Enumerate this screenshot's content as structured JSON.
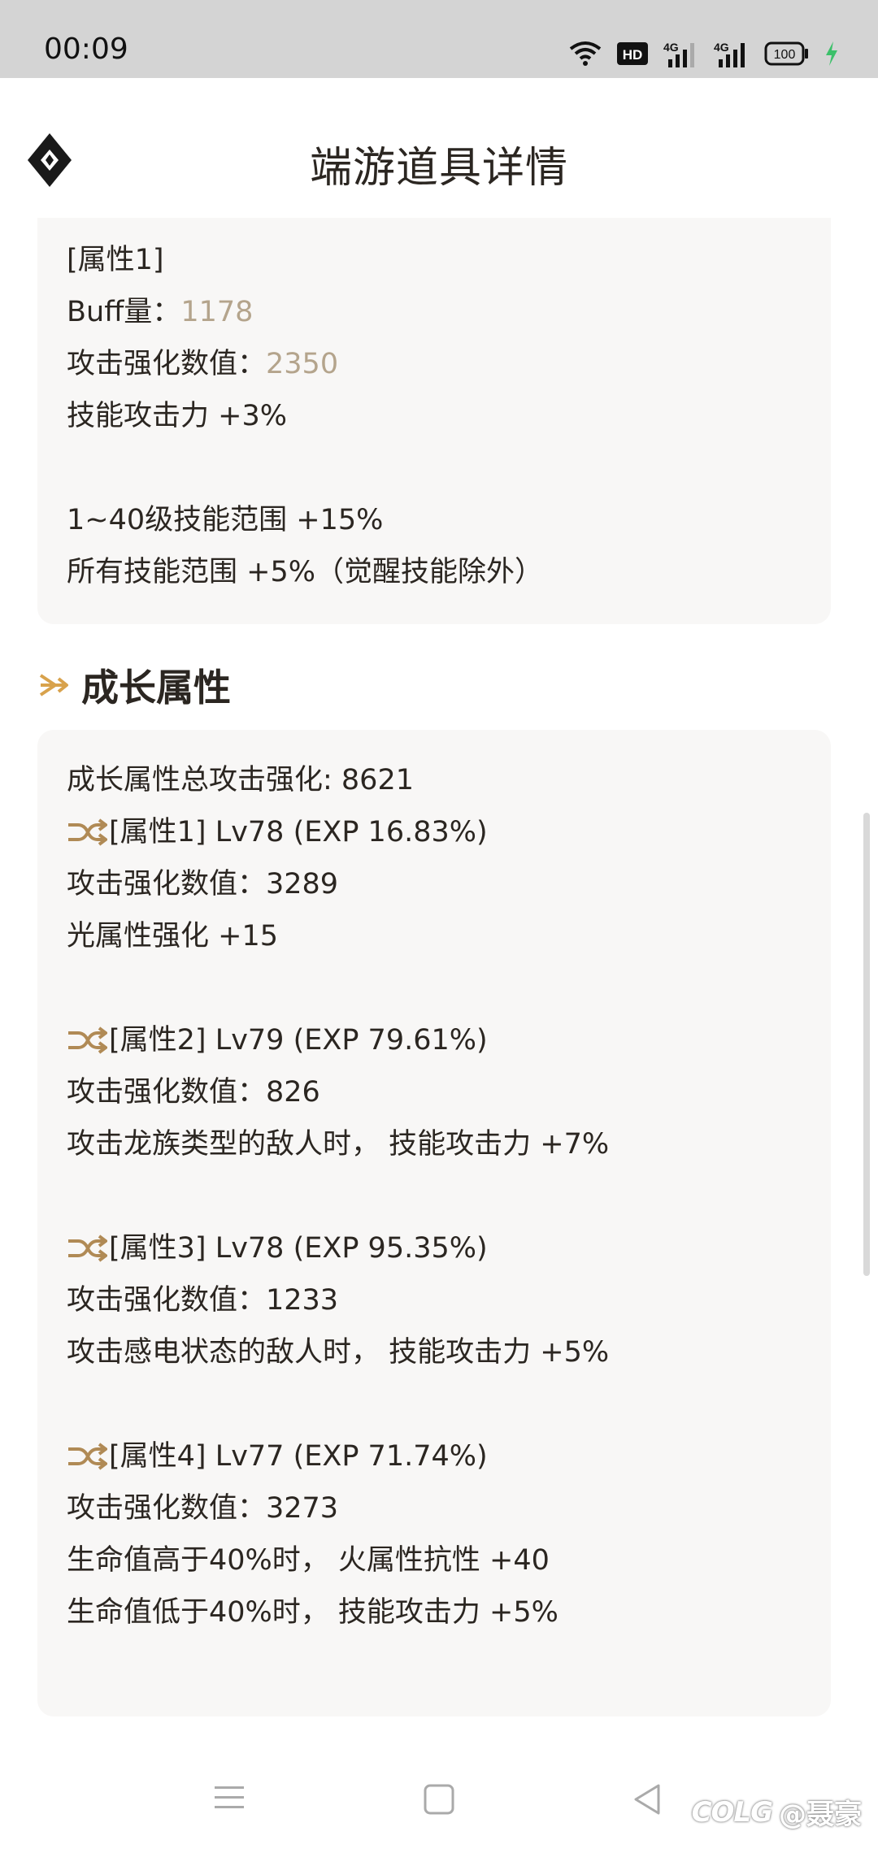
{
  "status_bar": {
    "time": "00:09",
    "battery": "100",
    "icons": [
      "wifi-icon",
      "hd-icon",
      "4g-signal-icon",
      "4g-signal-icon",
      "battery-icon",
      "charging-icon"
    ],
    "hd_label": "HD",
    "network_label_1": "4G",
    "network_label_2": "4G"
  },
  "header": {
    "title": "端游道具详情",
    "logo_icon": "diamond-logo-icon"
  },
  "card1": {
    "lines": [
      {
        "label": "[属性1]",
        "value": ""
      },
      {
        "label": "Buff量：",
        "value": "1178"
      },
      {
        "label": "攻击强化数值：",
        "value": "2350"
      },
      {
        "label": "技能攻击力 +3%",
        "value": ""
      },
      {
        "label": "1~40级技能范围 +15%",
        "value": ""
      },
      {
        "label": "所有技能范围 +5%（觉醒技能除外）",
        "value": ""
      }
    ]
  },
  "growth": {
    "section_title": "成长属性",
    "total": "成长属性总攻击强化: 8621",
    "groups": [
      {
        "header": "[属性1] Lv78 (EXP 16.83%)",
        "lines": [
          "攻击强化数值：3289",
          "光属性强化 +15"
        ]
      },
      {
        "header": "[属性2] Lv79 (EXP 79.61%)",
        "lines": [
          "攻击强化数值：826",
          "攻击龙族类型的敌人时， 技能攻击力 +7%"
        ]
      },
      {
        "header": "[属性3] Lv78 (EXP 95.35%)",
        "lines": [
          "攻击强化数值：1233",
          "攻击感电状态的敌人时， 技能攻击力 +5%"
        ]
      },
      {
        "header": "[属性4] Lv77 (EXP 71.74%)",
        "lines": [
          "攻击强化数值：3273",
          "生命值高于40%时， 火属性抗性 +40",
          "生命值低于40%时， 技能攻击力 +5%"
        ]
      }
    ]
  },
  "watermark": {
    "logo": "COLG",
    "user": "@聂豪"
  },
  "colors": {
    "accent_gold": "#d8a24c",
    "value_tan": "#b4a48c",
    "card_bg": "#f8f7f6",
    "text": "#2b2621"
  }
}
